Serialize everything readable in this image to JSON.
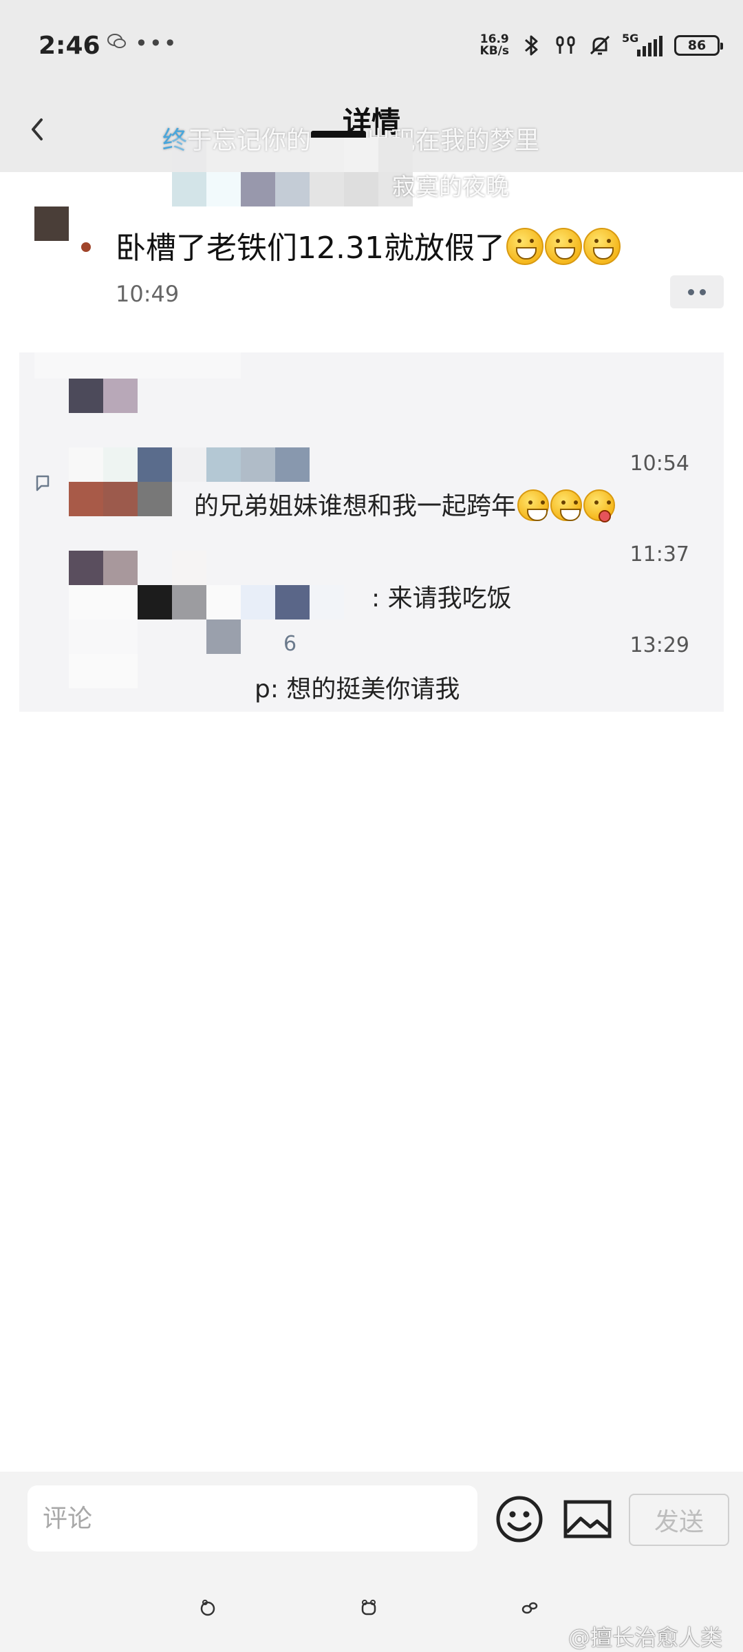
{
  "status_bar": {
    "time": "2:46",
    "network_speed_value": "16.9",
    "network_speed_unit": "KB/s",
    "network_type": "5G",
    "battery_level": "86"
  },
  "header": {
    "title": "详情"
  },
  "danmaku": {
    "line1_highlight": "终",
    "line1_rest": "于忘记你的",
    "line1_end": "出现在我的梦里",
    "line2": "寂寞的夜晚"
  },
  "post": {
    "text": "卧槽了老铁们12.31就放假了",
    "time": "10:49"
  },
  "comments": [
    {
      "time": "10:54",
      "text": "的兄弟姐妹谁想和我一起跨年"
    },
    {
      "time": "11:37",
      "text": ": 来请我吃饭"
    },
    {
      "time": "13:29",
      "name_fragment": "6",
      "text": "p: 想的挺美你请我"
    }
  ],
  "input": {
    "placeholder": "评论",
    "send_label": "发送"
  },
  "watermark": "@擅长治愈人类",
  "colors": {
    "header_bg": "#ebebeb",
    "panel_bg": "#f4f4f6",
    "accent_blue": "#48a6dc"
  }
}
